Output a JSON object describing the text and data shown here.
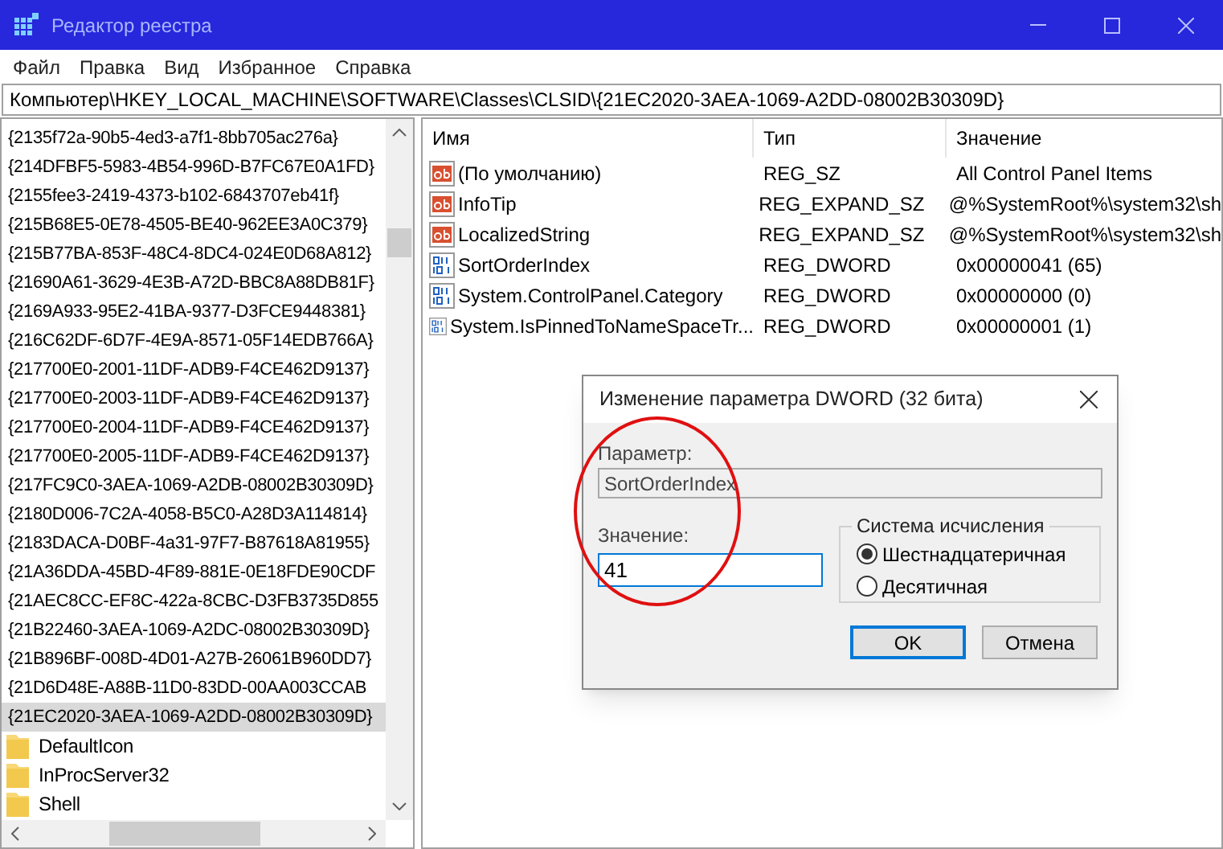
{
  "window": {
    "title": "Редактор реестра"
  },
  "menu": [
    "Файл",
    "Правка",
    "Вид",
    "Избранное",
    "Справка"
  ],
  "address": "Компьютер\\HKEY_LOCAL_MACHINE\\SOFTWARE\\Classes\\CLSID\\{21EC2020-3AEA-1069-A2DD-08002B30309D}",
  "tree": {
    "items": [
      {
        "kind": "key",
        "label": "{2135f72a-90b5-4ed3-a7f1-8bb705ac276a}",
        "selected": false
      },
      {
        "kind": "key",
        "label": "{214DFBF5-5983-4B54-996D-B7FC67E0A1FD}",
        "selected": false
      },
      {
        "kind": "key",
        "label": "{2155fee3-2419-4373-b102-6843707eb41f}",
        "selected": false
      },
      {
        "kind": "key",
        "label": "{215B68E5-0E78-4505-BE40-962EE3A0C379}",
        "selected": false
      },
      {
        "kind": "key",
        "label": "{215B77BA-853F-48C4-8DC4-024E0D68A812}",
        "selected": false
      },
      {
        "kind": "key",
        "label": "{21690A61-3629-4E3B-A72D-BBC8A88DB81F}",
        "selected": false
      },
      {
        "kind": "key",
        "label": "{2169A933-95E2-41BA-9377-D3FCE9448381}",
        "selected": false
      },
      {
        "kind": "key",
        "label": "{216C62DF-6D7F-4E9A-8571-05F14EDB766A}",
        "selected": false
      },
      {
        "kind": "key",
        "label": "{217700E0-2001-11DF-ADB9-F4CE462D9137}",
        "selected": false
      },
      {
        "kind": "key",
        "label": "{217700E0-2003-11DF-ADB9-F4CE462D9137}",
        "selected": false
      },
      {
        "kind": "key",
        "label": "{217700E0-2004-11DF-ADB9-F4CE462D9137}",
        "selected": false
      },
      {
        "kind": "key",
        "label": "{217700E0-2005-11DF-ADB9-F4CE462D9137}",
        "selected": false
      },
      {
        "kind": "key",
        "label": "{217FC9C0-3AEA-1069-A2DB-08002B30309D}",
        "selected": false
      },
      {
        "kind": "key",
        "label": "{2180D006-7C2A-4058-B5C0-A28D3A114814}",
        "selected": false
      },
      {
        "kind": "key",
        "label": "{2183DACA-D0BF-4a31-97F7-B87618A81955}",
        "selected": false
      },
      {
        "kind": "key",
        "label": "{21A36DDA-45BD-4F89-881E-0E18FDE90CDF",
        "selected": false
      },
      {
        "kind": "key",
        "label": "{21AEC8CC-EF8C-422a-8CBC-D3FB3735D855",
        "selected": false
      },
      {
        "kind": "key",
        "label": "{21B22460-3AEA-1069-A2DC-08002B30309D}",
        "selected": false
      },
      {
        "kind": "key",
        "label": "{21B896BF-008D-4D01-A27B-26061B960DD7}",
        "selected": false
      },
      {
        "kind": "key",
        "label": "{21D6D48E-A88B-11D0-83DD-00AA003CCAB",
        "selected": false
      },
      {
        "kind": "key",
        "label": "{21EC2020-3AEA-1069-A2DD-08002B30309D}",
        "selected": true
      },
      {
        "kind": "folder",
        "label": "DefaultIcon",
        "selected": false
      },
      {
        "kind": "folder",
        "label": "InProcServer32",
        "selected": false
      },
      {
        "kind": "folder",
        "label": "Shell",
        "selected": false
      }
    ]
  },
  "values": {
    "columns": [
      "Имя",
      "Тип",
      "Значение"
    ],
    "rows": [
      {
        "kind": "string",
        "name": "(По умолчанию)",
        "type": "REG_SZ",
        "data": "All Control Panel Items"
      },
      {
        "kind": "string",
        "name": "InfoTip",
        "type": "REG_EXPAND_SZ",
        "data": "@%SystemRoot%\\system32\\sh"
      },
      {
        "kind": "string",
        "name": "LocalizedString",
        "type": "REG_EXPAND_SZ",
        "data": "@%SystemRoot%\\system32\\sh"
      },
      {
        "kind": "dword",
        "name": "SortOrderIndex",
        "type": "REG_DWORD",
        "data": "0x00000041 (65)"
      },
      {
        "kind": "dword",
        "name": "System.ControlPanel.Category",
        "type": "REG_DWORD",
        "data": "0x00000000 (0)"
      },
      {
        "kind": "dword",
        "name": "System.IsPinnedToNameSpaceTr...",
        "type": "REG_DWORD",
        "data": "0x00000001 (1)"
      }
    ]
  },
  "dialog": {
    "title": "Изменение параметра DWORD (32 бита)",
    "parameter_label": "Параметр:",
    "parameter_value": "SortOrderIndex",
    "value_label": "Значение:",
    "value": "41",
    "base_label": "Система исчисления",
    "base_options": [
      {
        "label": "Шестнадцатеричная",
        "selected": true
      },
      {
        "label": "Десятичная",
        "selected": false
      }
    ],
    "buttons": [
      {
        "label": "OK",
        "kind": "default"
      },
      {
        "label": "Отмена",
        "kind": "normal"
      }
    ]
  }
}
